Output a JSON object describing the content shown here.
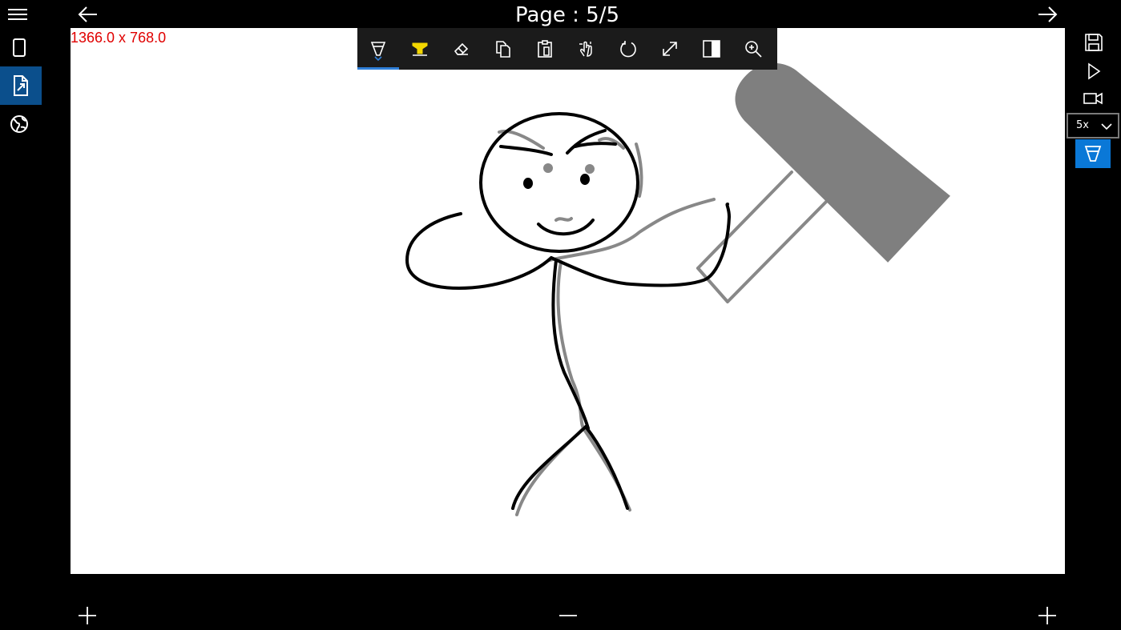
{
  "header": {
    "page_title": "Page : 5/5"
  },
  "canvas": {
    "resolution_text": "1366.0 x 768.0"
  },
  "toolbar": {
    "tools": [
      "pen",
      "highlighter",
      "eraser",
      "copy",
      "paste",
      "touch-pan",
      "rotate",
      "resize",
      "invert",
      "zoom"
    ],
    "active_tool": "pen"
  },
  "right_panel": {
    "zoom_value": "5x",
    "active_color": "#0a78d7"
  },
  "sidebar": {
    "items": [
      "page",
      "export-page",
      "web"
    ],
    "active": "export-page",
    "active_color": "#0b4f8c"
  },
  "colors": {
    "background": "#000000",
    "canvas": "#ffffff",
    "resolution_text": "#e00000",
    "ink_black": "#000000",
    "ink_gray": "#888888",
    "highlighter": "#f2d600"
  }
}
